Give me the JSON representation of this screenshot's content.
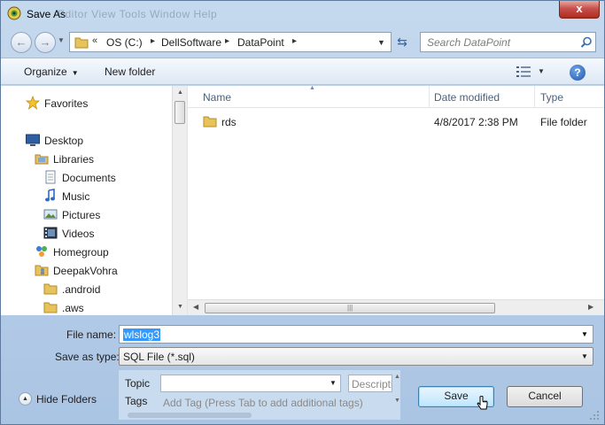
{
  "window": {
    "title": "Save As",
    "title_ghost": "Editor   View   Tools   Window   Help",
    "close_label": "x"
  },
  "nav": {
    "back_glyph": "←",
    "forward_glyph": "→",
    "refresh_glyph": "⇆"
  },
  "address": {
    "overflow": "«",
    "crumbs": [
      "OS (C:)",
      "DellSoftware",
      "DataPoint"
    ],
    "separator": "▸"
  },
  "search": {
    "placeholder": "Search DataPoint"
  },
  "toolbar": {
    "organize": "Organize",
    "new_folder": "New folder",
    "help": "?"
  },
  "nav_pane": {
    "items": [
      {
        "label": "Favorites",
        "icon": "star-icon"
      },
      {
        "label": "Desktop",
        "icon": "desktop-icon"
      },
      {
        "label": "Libraries",
        "icon": "libraries-icon"
      },
      {
        "label": "Documents",
        "icon": "documents-icon"
      },
      {
        "label": "Music",
        "icon": "music-icon"
      },
      {
        "label": "Pictures",
        "icon": "pictures-icon"
      },
      {
        "label": "Videos",
        "icon": "videos-icon"
      },
      {
        "label": "Homegroup",
        "icon": "homegroup-icon"
      },
      {
        "label": "DeepakVohra",
        "icon": "user-folder-icon"
      },
      {
        "label": ".android",
        "icon": "folder-icon"
      },
      {
        "label": ".aws",
        "icon": "folder-icon"
      }
    ]
  },
  "file_list": {
    "columns": [
      "Name",
      "Date modified",
      "Type"
    ],
    "rows": [
      {
        "name": "rds",
        "date": "4/8/2017 2:38 PM",
        "type": "File folder"
      }
    ]
  },
  "form": {
    "file_name_label": "File name:",
    "file_name_value": "wlslog3",
    "save_type_label": "Save as type:",
    "save_type_value": "SQL File (*.sql)",
    "topic_label": "Topic",
    "tags_label": "Tags",
    "description_placeholder": "Descriptio",
    "tags_placeholder": "Add Tag (Press Tab to add additional tags)"
  },
  "footer": {
    "hide_folders": "Hide Folders",
    "save": "Save",
    "cancel": "Cancel"
  },
  "colors": {
    "frame": "#b9d1ea",
    "selection": "#3399ff",
    "close": "#c75050",
    "save_button": "#bee6fd"
  }
}
